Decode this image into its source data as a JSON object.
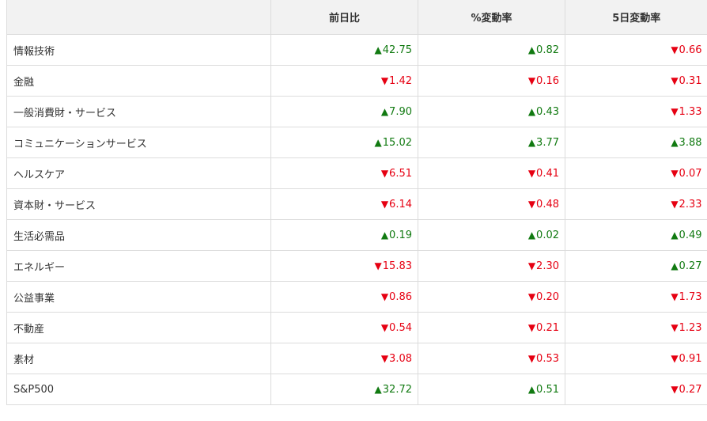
{
  "colors": {
    "up": "#117a11",
    "down": "#e60012",
    "header_bg": "#f2f2f2",
    "border": "#dcdcdc"
  },
  "table": {
    "headers": [
      "",
      "前日比",
      "%変動率",
      "5日変動率"
    ],
    "rows": [
      {
        "name": "情報技術",
        "change": {
          "dir": "up",
          "value": "42.75"
        },
        "pct": {
          "dir": "up",
          "value": "0.82"
        },
        "pct5d": {
          "dir": "down",
          "value": "0.66"
        }
      },
      {
        "name": "金融",
        "change": {
          "dir": "down",
          "value": "1.42"
        },
        "pct": {
          "dir": "down",
          "value": "0.16"
        },
        "pct5d": {
          "dir": "down",
          "value": "0.31"
        }
      },
      {
        "name": "一般消費財・サービス",
        "change": {
          "dir": "up",
          "value": "7.90"
        },
        "pct": {
          "dir": "up",
          "value": "0.43"
        },
        "pct5d": {
          "dir": "down",
          "value": "1.33"
        }
      },
      {
        "name": "コミュニケーションサービス",
        "change": {
          "dir": "up",
          "value": "15.02"
        },
        "pct": {
          "dir": "up",
          "value": "3.77"
        },
        "pct5d": {
          "dir": "up",
          "value": "3.88"
        }
      },
      {
        "name": "ヘルスケア",
        "change": {
          "dir": "down",
          "value": "6.51"
        },
        "pct": {
          "dir": "down",
          "value": "0.41"
        },
        "pct5d": {
          "dir": "down",
          "value": "0.07"
        }
      },
      {
        "name": "資本財・サービス",
        "change": {
          "dir": "down",
          "value": "6.14"
        },
        "pct": {
          "dir": "down",
          "value": "0.48"
        },
        "pct5d": {
          "dir": "down",
          "value": "2.33"
        }
      },
      {
        "name": "生活必需品",
        "change": {
          "dir": "up",
          "value": "0.19"
        },
        "pct": {
          "dir": "up",
          "value": "0.02"
        },
        "pct5d": {
          "dir": "up",
          "value": "0.49"
        }
      },
      {
        "name": "エネルギー",
        "change": {
          "dir": "down",
          "value": "15.83"
        },
        "pct": {
          "dir": "down",
          "value": "2.30"
        },
        "pct5d": {
          "dir": "up",
          "value": "0.27"
        }
      },
      {
        "name": "公益事業",
        "change": {
          "dir": "down",
          "value": "0.86"
        },
        "pct": {
          "dir": "down",
          "value": "0.20"
        },
        "pct5d": {
          "dir": "down",
          "value": "1.73"
        }
      },
      {
        "name": "不動産",
        "change": {
          "dir": "down",
          "value": "0.54"
        },
        "pct": {
          "dir": "down",
          "value": "0.21"
        },
        "pct5d": {
          "dir": "down",
          "value": "1.23"
        }
      },
      {
        "name": "素材",
        "change": {
          "dir": "down",
          "value": "3.08"
        },
        "pct": {
          "dir": "down",
          "value": "0.53"
        },
        "pct5d": {
          "dir": "down",
          "value": "0.91"
        }
      },
      {
        "name": "S&P500",
        "change": {
          "dir": "up",
          "value": "32.72"
        },
        "pct": {
          "dir": "up",
          "value": "0.51"
        },
        "pct5d": {
          "dir": "down",
          "value": "0.27"
        }
      }
    ]
  }
}
